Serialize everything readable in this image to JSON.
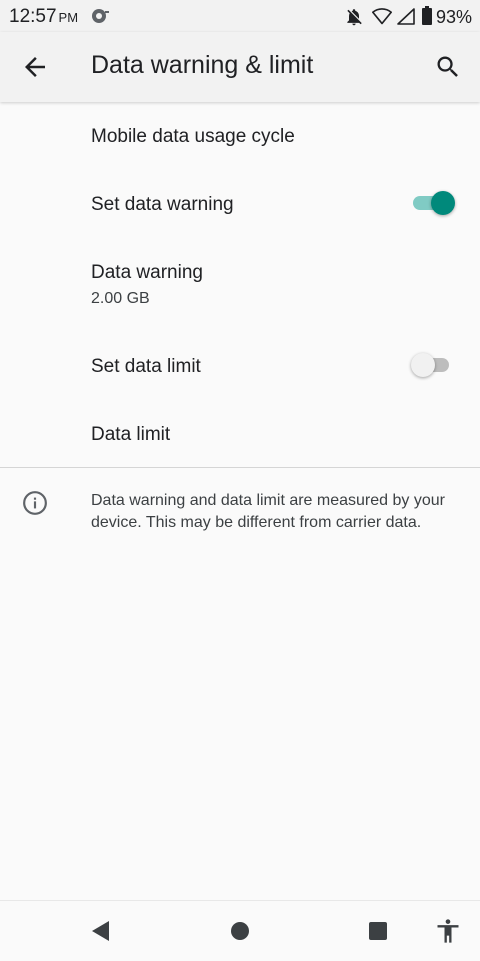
{
  "status_bar": {
    "time": "12:57",
    "ampm": "PM",
    "icons": [
      "sync-icon",
      "notifications-off-icon",
      "wifi-icon",
      "cell-signal-icon",
      "battery-icon"
    ],
    "battery": "93%"
  },
  "app_bar": {
    "title": "Data warning & limit",
    "back_icon": "arrow-back-icon",
    "search_icon": "search-icon"
  },
  "settings": {
    "usage_cycle": {
      "label": "Mobile data usage cycle"
    },
    "set_warning": {
      "label": "Set data warning",
      "enabled": true
    },
    "warning": {
      "label": "Data warning",
      "value": "2.00 GB"
    },
    "set_limit": {
      "label": "Set data limit",
      "enabled": false
    },
    "limit": {
      "label": "Data limit"
    }
  },
  "footer_info": {
    "icon": "info-icon",
    "text": "Data warning and data limit are measured by your device. This may be different from carrier data."
  },
  "nav_bar": {
    "buttons": [
      "back-triangle-icon",
      "home-circle-icon",
      "recents-square-icon",
      "accessibility-icon"
    ]
  },
  "colors": {
    "accent": "#00897b",
    "accent_track": "#80cbc4",
    "background": "#fafafa",
    "appbar": "#f2f2f2"
  }
}
